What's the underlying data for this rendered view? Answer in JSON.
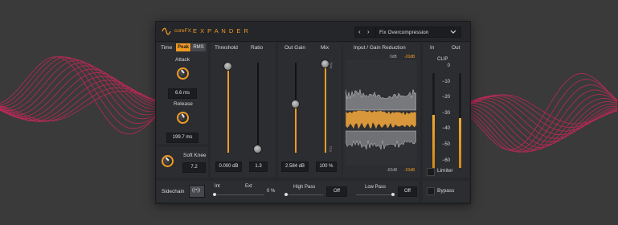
{
  "colors": {
    "accent": "#f09a23",
    "background": "#3a3a3a",
    "wave": "#c8285a",
    "panel": "#2b2d31"
  },
  "header": {
    "logo_icon": "sine-wave-icon",
    "brand": "coreFX",
    "title": "E X P A N D E R",
    "preset": "Fix Overcompression"
  },
  "detection": {
    "label": "Time",
    "peak": "Peak",
    "rms": "RMS"
  },
  "attack": {
    "label": "Attack",
    "value": "6.6 ms"
  },
  "release": {
    "label": "Release",
    "value": "199.7 ms"
  },
  "soft_knee": {
    "label": "Soft Knee",
    "value": "7.2"
  },
  "threshold": {
    "label": "Threshold",
    "value": "0.000 dB",
    "level": 0.97
  },
  "ratio": {
    "label": "Ratio",
    "value": "1.3",
    "level": 0.05
  },
  "out_gain": {
    "label": "Out Gain",
    "value": "2.584 dB",
    "level": 0.55
  },
  "mix": {
    "label": "Mix",
    "value": "100 %",
    "level": 1.0,
    "top_mark": "Wet",
    "bottom_mark": "Dry"
  },
  "graph": {
    "label": "Input / Gain Reduction",
    "top_db": "0dB",
    "top_db_accent": "-20dB",
    "bottom_db": "-60dB",
    "bottom_db_accent": "-20dB"
  },
  "meters": {
    "in": "In",
    "out": "Out",
    "clip": "CLIP",
    "scale": [
      "0",
      "−10",
      "−20",
      "−30",
      "−40",
      "−50",
      "−60"
    ]
  },
  "limiter": {
    "label": "Limiter"
  },
  "sidechain": {
    "label": "Sidechain",
    "icon": "broadcast-icon",
    "int": "Int",
    "ext": "Ext",
    "value": "0 %"
  },
  "high_pass": {
    "label": "High Pass",
    "value": "Off"
  },
  "low_pass": {
    "label": "Low Pass",
    "value": "Off"
  },
  "bypass": {
    "label": "Bypass"
  }
}
